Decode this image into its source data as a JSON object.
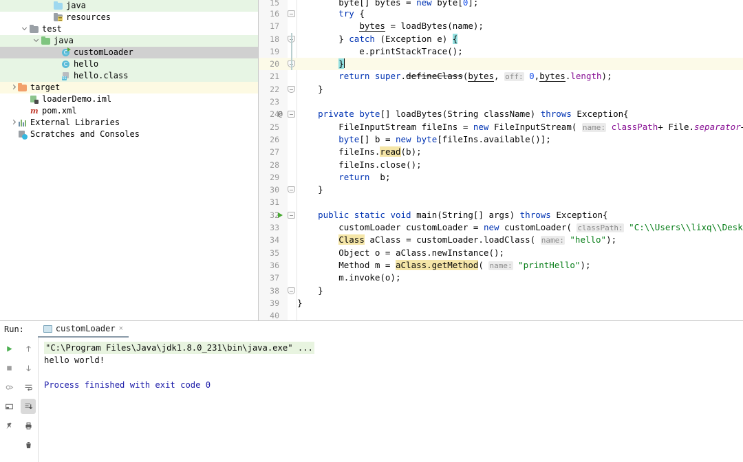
{
  "project_tree": {
    "name": "project-tree",
    "items": [
      {
        "label": "java",
        "indent": 77,
        "icon": "folder-blue",
        "arrow": "none",
        "highlight": "green"
      },
      {
        "label": "resources",
        "indent": 77,
        "icon": "folder-resources",
        "arrow": "none",
        "highlight": "none"
      },
      {
        "label": "test",
        "indent": 42,
        "icon": "folder-gray",
        "arrow": "expanded",
        "highlight": "none"
      },
      {
        "label": "java",
        "indent": 59,
        "icon": "folder-green",
        "arrow": "expanded",
        "highlight": "green"
      },
      {
        "label": "customLoader",
        "indent": 88,
        "icon": "class-runnable",
        "arrow": "none",
        "highlight": "selected"
      },
      {
        "label": "hello",
        "indent": 88,
        "icon": "class",
        "arrow": "none",
        "highlight": "green"
      },
      {
        "label": "hello.class",
        "indent": 88,
        "icon": "class-file",
        "arrow": "none",
        "highlight": "green"
      },
      {
        "label": "target",
        "indent": 25,
        "icon": "folder-orange",
        "arrow": "collapsed",
        "highlight": "yellow"
      },
      {
        "label": "loaderDemo.iml",
        "indent": 42,
        "icon": "iml-file",
        "arrow": "none",
        "highlight": "none"
      },
      {
        "label": "pom.xml",
        "indent": 42,
        "icon": "maven-file",
        "arrow": "none",
        "highlight": "none"
      },
      {
        "label": "External Libraries",
        "indent": 25,
        "icon": "external-libraries",
        "arrow": "collapsed",
        "highlight": "none"
      },
      {
        "label": "Scratches and Consoles",
        "indent": 25,
        "icon": "scratches",
        "arrow": "none",
        "highlight": "none"
      }
    ]
  },
  "editor": {
    "name": "code-editor",
    "file": "customLoader",
    "first_visible_line": 15,
    "current_line": 20,
    "lines": [
      {
        "n": 15,
        "clipped": true,
        "fold": "none",
        "marker": "none",
        "cur": false,
        "tokens": [
          {
            "t": "        byte[] ",
            "c": ""
          },
          {
            "t": "bytes",
            "c": "undl"
          },
          {
            "t": " = ",
            "c": ""
          },
          {
            "t": "new",
            "c": "kw"
          },
          {
            "t": " byte[",
            "c": ""
          },
          {
            "t": "0",
            "c": "num"
          },
          {
            "t": "];",
            "c": ""
          }
        ]
      },
      {
        "n": 16,
        "fold": "open",
        "marker": "none",
        "cur": false,
        "tokens": [
          {
            "t": "        ",
            "c": ""
          },
          {
            "t": "try",
            "c": "kw"
          },
          {
            "t": " {",
            "c": ""
          }
        ]
      },
      {
        "n": 17,
        "fold": "none",
        "marker": "none",
        "cur": false,
        "tokens": [
          {
            "t": "            ",
            "c": ""
          },
          {
            "t": "bytes",
            "c": "undl"
          },
          {
            "t": " = loadBytes(name);",
            "c": ""
          }
        ]
      },
      {
        "n": 18,
        "fold": "half",
        "marker": "none",
        "cur": false,
        "tokens": [
          {
            "t": "        } ",
            "c": ""
          },
          {
            "t": "catch",
            "c": "kw"
          },
          {
            "t": " (Exception e) ",
            "c": ""
          },
          {
            "t": "{",
            "c": "brmatch"
          }
        ]
      },
      {
        "n": 19,
        "fold": "none",
        "marker": "none",
        "cur": false,
        "tokens": [
          {
            "t": "            e.printStackTrace();",
            "c": ""
          }
        ]
      },
      {
        "n": 20,
        "fold": "half",
        "marker": "none",
        "cur": true,
        "tokens": [
          {
            "t": "        ",
            "c": ""
          },
          {
            "t": "}",
            "c": "brmatch"
          },
          {
            "t": "",
            "c": "caret"
          }
        ]
      },
      {
        "n": 21,
        "fold": "none",
        "marker": "none",
        "cur": false,
        "tokens": [
          {
            "t": "        ",
            "c": ""
          },
          {
            "t": "return",
            "c": "kw"
          },
          {
            "t": " ",
            "c": ""
          },
          {
            "t": "super",
            "c": "kw"
          },
          {
            "t": ".",
            "c": ""
          },
          {
            "t": "defineClass",
            "c": "strike"
          },
          {
            "t": "(",
            "c": ""
          },
          {
            "t": "bytes",
            "c": "undl"
          },
          {
            "t": ", ",
            "c": ""
          },
          {
            "t": "off:",
            "c": "hintp"
          },
          {
            "t": " ",
            "c": ""
          },
          {
            "t": "0",
            "c": "num"
          },
          {
            "t": ",",
            "c": ""
          },
          {
            "t": "bytes",
            "c": "undl"
          },
          {
            "t": ".",
            "c": ""
          },
          {
            "t": "length",
            "c": "fld"
          },
          {
            "t": ");",
            "c": ""
          }
        ]
      },
      {
        "n": 22,
        "fold": "half",
        "marker": "none",
        "cur": false,
        "tokens": [
          {
            "t": "    }",
            "c": ""
          }
        ]
      },
      {
        "n": 23,
        "fold": "none",
        "marker": "none",
        "cur": false,
        "tokens": [
          {
            "t": "",
            "c": ""
          }
        ]
      },
      {
        "n": 24,
        "fold": "open",
        "marker": "at",
        "cur": false,
        "tokens": [
          {
            "t": "    ",
            "c": ""
          },
          {
            "t": "private",
            "c": "kw"
          },
          {
            "t": " ",
            "c": ""
          },
          {
            "t": "byte",
            "c": "kw"
          },
          {
            "t": "[] loadBytes(String className) ",
            "c": ""
          },
          {
            "t": "throws",
            "c": "kw"
          },
          {
            "t": " Exception{",
            "c": ""
          }
        ]
      },
      {
        "n": 25,
        "fold": "none",
        "marker": "none",
        "cur": false,
        "tokens": [
          {
            "t": "        FileInputStream fileIns = ",
            "c": ""
          },
          {
            "t": "new",
            "c": "kw"
          },
          {
            "t": " FileInputStream( ",
            "c": ""
          },
          {
            "t": "name:",
            "c": "hintp"
          },
          {
            "t": " ",
            "c": ""
          },
          {
            "t": "classPath",
            "c": "fld"
          },
          {
            "t": "+ File.",
            "c": ""
          },
          {
            "t": "separator",
            "c": "sfld"
          },
          {
            "t": "+className.",
            "c": ""
          }
        ]
      },
      {
        "n": 26,
        "fold": "none",
        "marker": "none",
        "cur": false,
        "tokens": [
          {
            "t": "        ",
            "c": ""
          },
          {
            "t": "byte",
            "c": "kw"
          },
          {
            "t": "[] b = ",
            "c": ""
          },
          {
            "t": "new",
            "c": "kw"
          },
          {
            "t": " ",
            "c": ""
          },
          {
            "t": "byte",
            "c": "kw"
          },
          {
            "t": "[fileIns.available()];",
            "c": ""
          }
        ]
      },
      {
        "n": 27,
        "fold": "none",
        "marker": "none",
        "cur": false,
        "tokens": [
          {
            "t": "        fileIns.",
            "c": ""
          },
          {
            "t": "read",
            "c": "srch"
          },
          {
            "t": "(b);",
            "c": ""
          }
        ]
      },
      {
        "n": 28,
        "fold": "none",
        "marker": "none",
        "cur": false,
        "tokens": [
          {
            "t": "        fileIns.close();",
            "c": ""
          }
        ]
      },
      {
        "n": 29,
        "fold": "none",
        "marker": "none",
        "cur": false,
        "tokens": [
          {
            "t": "        ",
            "c": ""
          },
          {
            "t": "return",
            "c": "kw"
          },
          {
            "t": "  b;",
            "c": ""
          }
        ]
      },
      {
        "n": 30,
        "fold": "half",
        "marker": "none",
        "cur": false,
        "tokens": [
          {
            "t": "    }",
            "c": ""
          }
        ]
      },
      {
        "n": 31,
        "fold": "none",
        "marker": "none",
        "cur": false,
        "tokens": [
          {
            "t": "",
            "c": ""
          }
        ]
      },
      {
        "n": 32,
        "fold": "open",
        "marker": "run",
        "cur": false,
        "tokens": [
          {
            "t": "    ",
            "c": ""
          },
          {
            "t": "public",
            "c": "kw"
          },
          {
            "t": " ",
            "c": ""
          },
          {
            "t": "static",
            "c": "kw"
          },
          {
            "t": " ",
            "c": ""
          },
          {
            "t": "void",
            "c": "kw"
          },
          {
            "t": " main(String[] args) ",
            "c": ""
          },
          {
            "t": "throws",
            "c": "kw"
          },
          {
            "t": " Exception{",
            "c": ""
          }
        ]
      },
      {
        "n": 33,
        "fold": "none",
        "marker": "none",
        "cur": false,
        "tokens": [
          {
            "t": "        customLoader customLoader = ",
            "c": ""
          },
          {
            "t": "new",
            "c": "kw"
          },
          {
            "t": " customLoader( ",
            "c": ""
          },
          {
            "t": "classPath:",
            "c": "hintp"
          },
          {
            "t": " ",
            "c": ""
          },
          {
            "t": "\"C:\\\\Users\\\\lixq\\\\Desktop\\\\loade",
            "c": "str"
          }
        ]
      },
      {
        "n": 34,
        "fold": "none",
        "marker": "none",
        "cur": false,
        "tokens": [
          {
            "t": "        ",
            "c": ""
          },
          {
            "t": "Class",
            "c": "srch"
          },
          {
            "t": " aClass = customLoader.loadClass( ",
            "c": ""
          },
          {
            "t": "name:",
            "c": "hintp"
          },
          {
            "t": " ",
            "c": ""
          },
          {
            "t": "\"hello\"",
            "c": "str"
          },
          {
            "t": ");",
            "c": ""
          }
        ]
      },
      {
        "n": 35,
        "fold": "none",
        "marker": "none",
        "cur": false,
        "tokens": [
          {
            "t": "        Object o = aClass.newInstance();",
            "c": ""
          }
        ]
      },
      {
        "n": 36,
        "fold": "none",
        "marker": "none",
        "cur": false,
        "tokens": [
          {
            "t": "        Method m = ",
            "c": ""
          },
          {
            "t": "aClass.getMethod",
            "c": "srch"
          },
          {
            "t": "( ",
            "c": ""
          },
          {
            "t": "name:",
            "c": "hintp"
          },
          {
            "t": " ",
            "c": ""
          },
          {
            "t": "\"printHello\"",
            "c": "str"
          },
          {
            "t": ");",
            "c": ""
          }
        ]
      },
      {
        "n": 37,
        "fold": "none",
        "marker": "none",
        "cur": false,
        "tokens": [
          {
            "t": "        m.invoke(o);",
            "c": ""
          }
        ]
      },
      {
        "n": 38,
        "fold": "half",
        "marker": "none",
        "cur": false,
        "tokens": [
          {
            "t": "    }",
            "c": ""
          }
        ]
      },
      {
        "n": 39,
        "fold": "none",
        "marker": "none",
        "cur": false,
        "tokens": [
          {
            "t": "}",
            "c": ""
          }
        ]
      },
      {
        "n": 40,
        "fold": "none",
        "marker": "none",
        "cur": false,
        "tokens": [
          {
            "t": "",
            "c": ""
          }
        ]
      }
    ]
  },
  "run_panel": {
    "name": "run-tool-window",
    "title": "Run:",
    "tab_label": "customLoader",
    "tab_close": "×",
    "left_tools": [
      {
        "name": "rerun-button",
        "glyph": "▶"
      },
      {
        "name": "stop-button",
        "glyph": "■"
      },
      {
        "name": "rerun-failed-icon",
        "glyph": "⚙"
      },
      {
        "name": "layout-button",
        "glyph": "▤"
      },
      {
        "name": "pin-tab-button",
        "glyph": "📌"
      }
    ],
    "right_tools": [
      {
        "name": "up-the-stack-trace-button",
        "glyph": "↑",
        "active": false
      },
      {
        "name": "down-the-stack-trace-button",
        "glyph": "↓",
        "active": false
      },
      {
        "name": "soft-wrap-button",
        "glyph": "⇥",
        "active": false
      },
      {
        "name": "scroll-to-end-button",
        "glyph": "⤓",
        "active": true
      },
      {
        "name": "print-button",
        "glyph": "🖶",
        "active": false
      },
      {
        "name": "clear-all-button",
        "glyph": "🗑",
        "active": false
      }
    ],
    "console": {
      "command": "\"C:\\Program Files\\Java\\jdk1.8.0_231\\bin\\java.exe\" ...",
      "output": "hello world!",
      "exit_message": "Process finished with exit code 0"
    }
  },
  "colors": {
    "keyword": "#0033b3",
    "string": "#067d17",
    "number": "#1750eb",
    "field": "#871094",
    "test_source_bg": "#e7f5e4",
    "selection_bg": "#d0d0d0",
    "excluded_bg": "#fdfae3",
    "current_line_bg": "#fcfae8",
    "console_command_bg": "#e8f4e0",
    "exit_message_fg": "#1a1aa8",
    "run_green": "#48a832"
  }
}
